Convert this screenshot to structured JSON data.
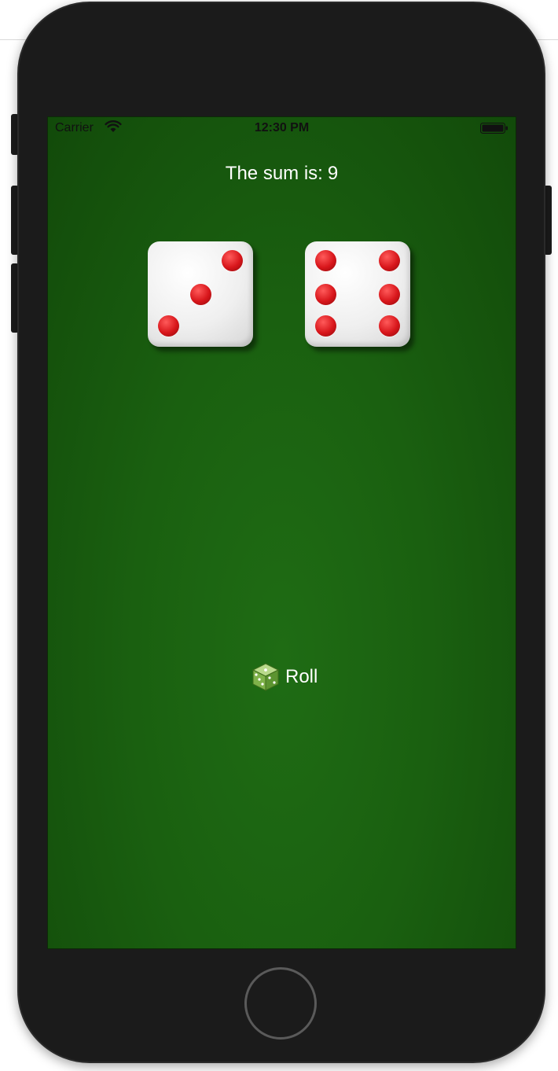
{
  "status_bar": {
    "carrier": "Carrier",
    "time": "12:30 PM",
    "wifi_icon": "wifi-icon",
    "battery_icon": "battery-icon"
  },
  "sum": {
    "prefix": "The sum is:",
    "value": "9"
  },
  "dice": [
    {
      "value": 3
    },
    {
      "value": 6
    }
  ],
  "roll_button": {
    "label": "Roll",
    "icon": "dice-icon"
  },
  "colors": {
    "felt": "#1a6010",
    "pip": "#d8161b",
    "die_face": "#efefef",
    "text": "#ffffff"
  }
}
